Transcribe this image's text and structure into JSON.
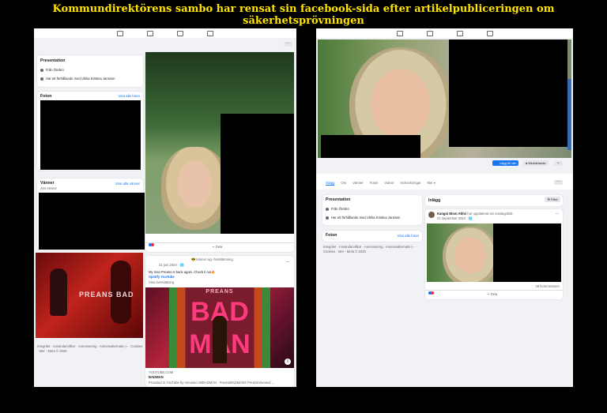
{
  "headline": "Kommundirektörens sambo har rensat sin facebook-sida efter artikelpubliceringen om säkerhetsprövningen",
  "colors": {
    "headline": "#ffe400",
    "fb_blue": "#1877f2"
  },
  "left": {
    "presentation": {
      "title": "Presentation",
      "from": "Från Örebro",
      "relationship": "Har ett förhållande med Ulrika Kristina Jansson"
    },
    "photos": {
      "title": "Foton",
      "see_all": "Visa alla foton"
    },
    "friends": {
      "title": "Vänner",
      "count": "294 vänner",
      "see_all": "Visa alla vänner"
    },
    "footer": "Integritet · Användarvillkor · Annonsering · Annonsalternativ ▷ · Cookies · Mer · Meta © 2025",
    "post1": {
      "share": "Dela"
    },
    "post2": {
      "feeling": "😎 känner sig i feststämning.",
      "date": "21 juni 2024 · 🌐",
      "text": "My man Preans is back again. Check it out🔥",
      "links": "Spotify YouTube",
      "translate": "Visa översättning",
      "video_title_top": "PREANS",
      "video_title_main": "BAD",
      "video_title_sub": "MAN",
      "domain": "YOUTUBE.COM",
      "link_title": "BADMAN",
      "link_desc": "Provided to YouTube by Amuseio ABBADMAN · PreansBADMAN℗ Preansreleased ..."
    },
    "album_thumb_text": "PREANS BAD"
  },
  "right": {
    "buttons": {
      "add_friend": "Lägg till vän",
      "message": "Meddelande"
    },
    "tabs": [
      "Inlägg",
      "Om",
      "Vänner",
      "Foton",
      "Videor",
      "Incheckningar",
      "Mer ▾"
    ],
    "presentation": {
      "title": "Presentation",
      "from": "Från Örebro",
      "relationship": "Har ett förhållande med Ulrika Kristina Jansson"
    },
    "photos": {
      "title": "Foton",
      "see_all": "Visa alla foton"
    },
    "footer": "Integritet · Användarvillkor · Annonsering · Annonsalternativ ▷ · Cookies · Mer · Meta © 2025",
    "posts": {
      "title": "Inlägg",
      "filter": "Filter",
      "author": "Kangni Elom Attivi",
      "action": "har uppdaterat sin omslagsbild.",
      "date": "21 september 2024 · 🌐",
      "comments": "28 kommentarer",
      "share": "Dela"
    }
  }
}
